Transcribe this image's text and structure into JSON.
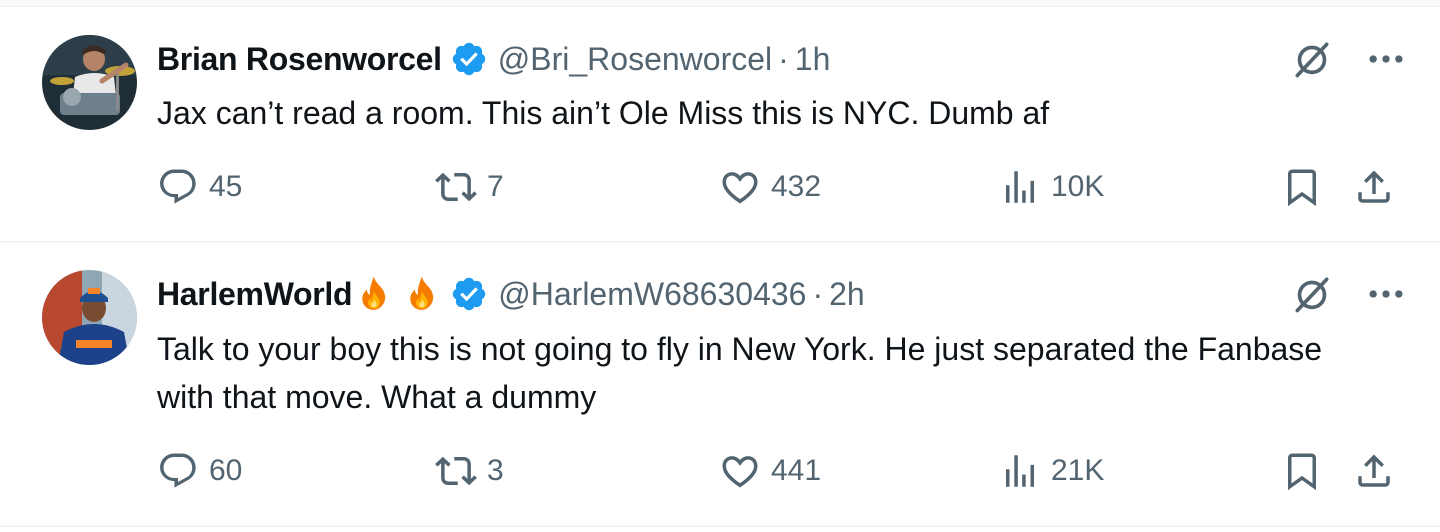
{
  "colors": {
    "text_primary": "#0f1419",
    "text_secondary": "#536471",
    "verified": "#1d9bf0",
    "divider": "#eff3f4"
  },
  "tweets": [
    {
      "author": "Brian Rosenworcel",
      "handle": "@Bri_Rosenworcel",
      "separator": "·",
      "time": "1h",
      "text": "Jax can’t read a room. This ain’t Ole Miss this is NYC. Dumb af",
      "replies": "45",
      "retweets": "7",
      "likes": "432",
      "views": "10K",
      "icons": [
        "verified-badge-icon",
        "grok-icon",
        "more-icon",
        "reply-icon",
        "retweet-icon",
        "like-icon",
        "views-icon",
        "bookmark-icon",
        "share-icon"
      ]
    },
    {
      "author": "HarlemWorld",
      "author_emoji": [
        "fire-emoji",
        "fire-emoji"
      ],
      "handle": "@HarlemW68630436",
      "separator": "·",
      "time": "2h",
      "text": "Talk to your boy this is not going to fly in New York. He just separated the Fanbase with that move. What a dummy",
      "replies": "60",
      "retweets": "3",
      "likes": "441",
      "views": "21K",
      "icons": [
        "verified-badge-icon",
        "grok-icon",
        "more-icon",
        "reply-icon",
        "retweet-icon",
        "like-icon",
        "views-icon",
        "bookmark-icon",
        "share-icon"
      ]
    }
  ]
}
